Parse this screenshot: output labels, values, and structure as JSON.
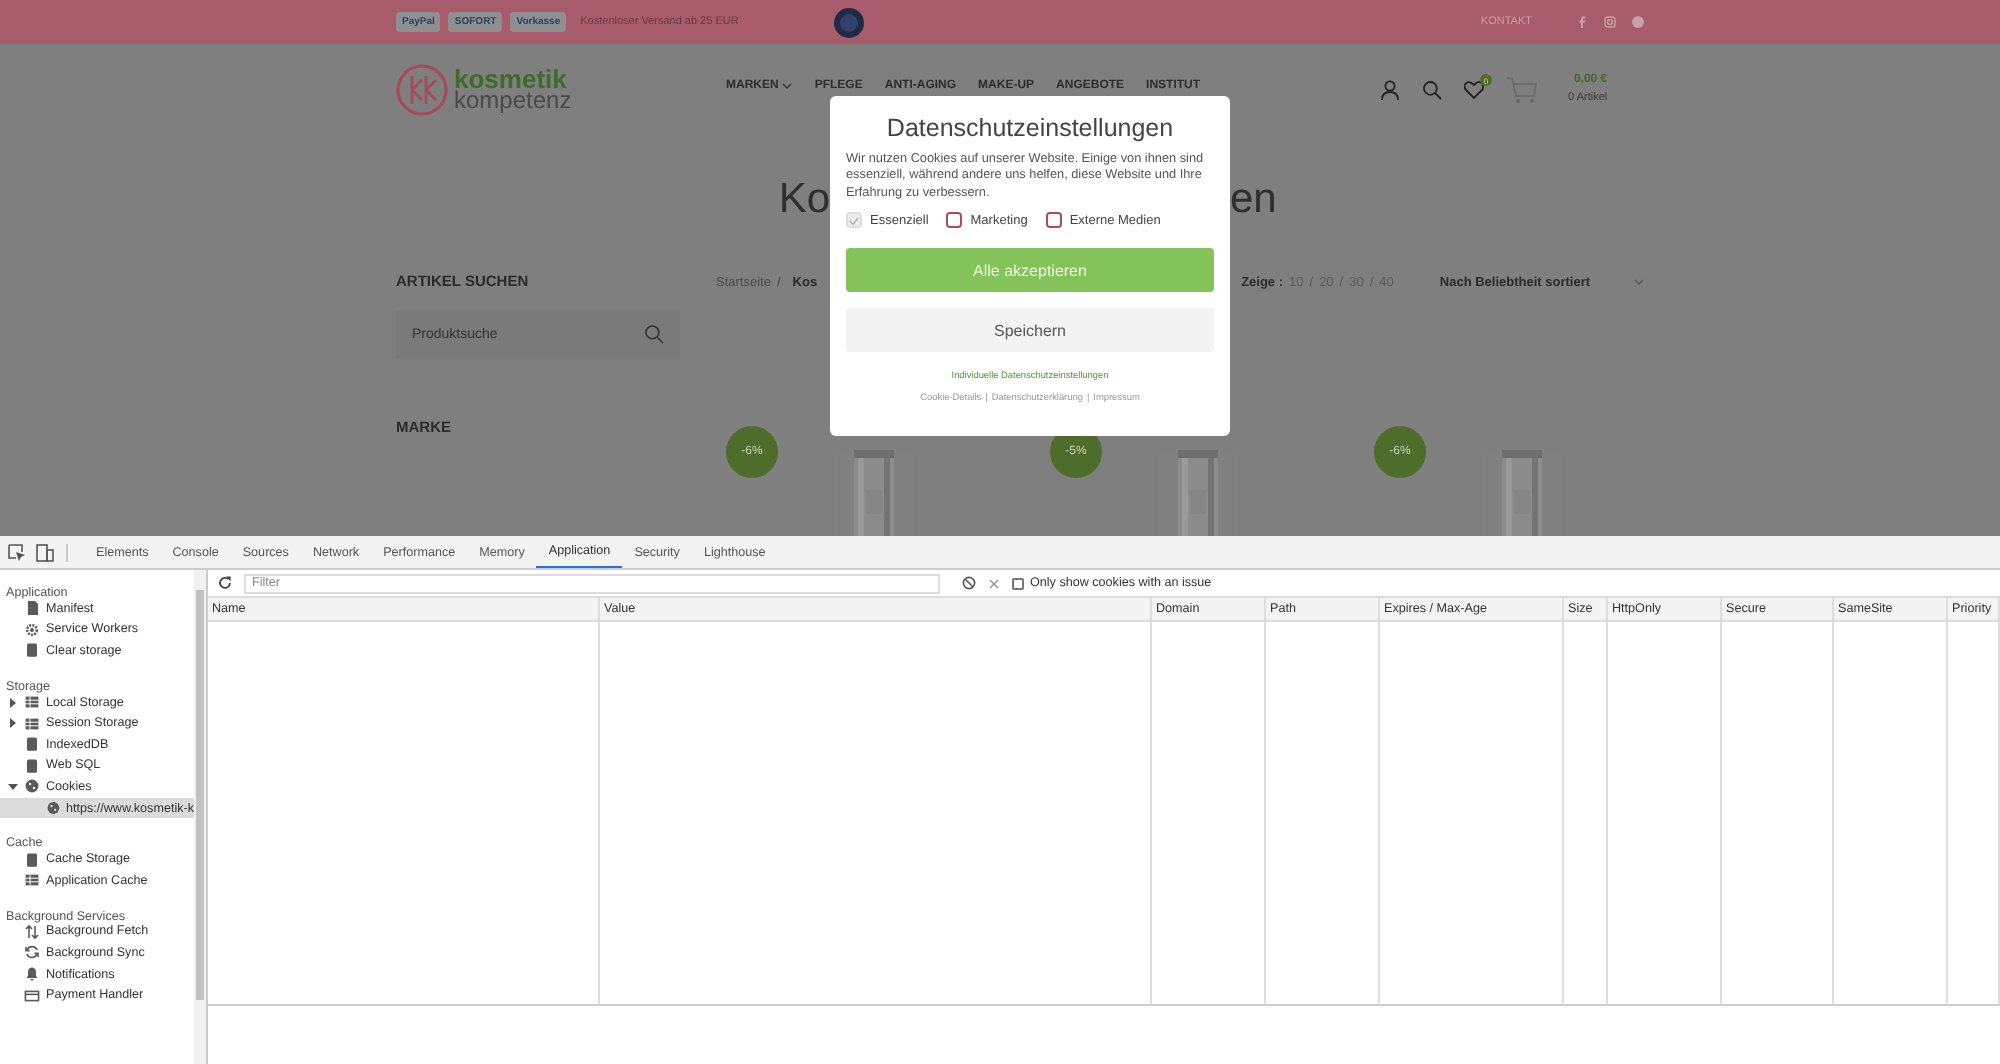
{
  "site": {
    "top_bar": {
      "payment_logos": [
        "PayPal",
        "SOFORT",
        "Vorkasse"
      ],
      "shipping_note": "Kostenloser Versand ab 25 EUR",
      "links": [
        "KONTAKT"
      ]
    },
    "logo": {
      "line_1": "kosmetik",
      "line_2": "kompetenz"
    },
    "nav": [
      {
        "label": "MARKEN",
        "dropdown": true
      },
      {
        "label": "PFLEGE",
        "dropdown": false
      },
      {
        "label": "ANTI-AGING",
        "dropdown": false
      },
      {
        "label": "MAKE-UP",
        "dropdown": false
      },
      {
        "label": "ANGEBOTE",
        "dropdown": false
      },
      {
        "label": "INSTITUT",
        "dropdown": false
      }
    ],
    "wishlist_count": "0",
    "cart": {
      "total": "0,00 €",
      "items": "0 Artikel"
    },
    "heading_left": "Ko",
    "heading_right": "en",
    "sidebar": {
      "search_title": "ARTIKEL SUCHEN",
      "search_placeholder": "Produktsuche",
      "filter_title": "MARKE"
    },
    "breadcrumb": {
      "home": "Startseite",
      "separator": "/",
      "current": "Kos"
    },
    "per_page": {
      "label": "Zeige :",
      "options": [
        "10",
        "20",
        "30",
        "40"
      ],
      "separator": "/"
    },
    "sort": "Nach Beliebtheit sortiert",
    "products": [
      {
        "badge": "-6%"
      },
      {
        "badge": "-5%"
      },
      {
        "badge": "-6%"
      }
    ]
  },
  "consent_dialog": {
    "title": "Datenschutzeinstellungen",
    "text": "Wir nutzen Cookies auf unserer Website. Einige von ihnen sind essenziell, während andere uns helfen, diese Website und Ihre Erfahrung zu verbessern.",
    "options": [
      {
        "label": "Essenziell",
        "checked": true,
        "disabled": true
      },
      {
        "label": "Marketing",
        "checked": false,
        "disabled": false
      },
      {
        "label": "Externe Medien",
        "checked": false,
        "disabled": false
      }
    ],
    "accept_all": "Alle akzeptieren",
    "save": "Speichern",
    "individual_link": "Individuelle Datenschutzeinstellungen",
    "footer_links": [
      "Cookie-Details",
      "Datenschutzerklärung",
      "Impressum"
    ],
    "footer_separator": "|"
  },
  "devtools": {
    "tabs": [
      {
        "label": "Elements",
        "selected": false
      },
      {
        "label": "Console",
        "selected": false
      },
      {
        "label": "Sources",
        "selected": false
      },
      {
        "label": "Network",
        "selected": false
      },
      {
        "label": "Performance",
        "selected": false
      },
      {
        "label": "Memory",
        "selected": false
      },
      {
        "label": "Application",
        "selected": true
      },
      {
        "label": "Security",
        "selected": false
      },
      {
        "label": "Lighthouse",
        "selected": false
      }
    ],
    "sidebar": [
      {
        "title": "Application",
        "items": [
          {
            "label": "Manifest",
            "kind": "file"
          },
          {
            "label": "Service Workers",
            "kind": "gear"
          },
          {
            "label": "Clear storage",
            "kind": "db"
          }
        ]
      },
      {
        "title": "Storage",
        "items": [
          {
            "label": "Local Storage",
            "kind": "grid",
            "expanded": false
          },
          {
            "label": "Session Storage",
            "kind": "grid",
            "expanded": false
          },
          {
            "label": "IndexedDB",
            "kind": "db"
          },
          {
            "label": "Web SQL",
            "kind": "db"
          },
          {
            "label": "Cookies",
            "kind": "cookie",
            "expanded": true,
            "children": [
              {
                "label": "https://www.kosmetik-k",
                "kind": "cookie",
                "selected": true
              }
            ]
          }
        ]
      },
      {
        "title": "Cache",
        "items": [
          {
            "label": "Cache Storage",
            "kind": "db"
          },
          {
            "label": "Application Cache",
            "kind": "grid"
          }
        ]
      },
      {
        "title": "Background Services",
        "items": [
          {
            "label": "Background Fetch",
            "kind": "arrows"
          },
          {
            "label": "Background Sync",
            "kind": "sync"
          },
          {
            "label": "Notifications",
            "kind": "bell"
          },
          {
            "label": "Payment Handler",
            "kind": "card"
          }
        ]
      }
    ],
    "filter": {
      "placeholder": "Filter"
    },
    "issue_only": {
      "label": "Only show cookies with an issue",
      "checked": false
    },
    "columns": [
      "Name",
      "Value",
      "Domain",
      "Path",
      "Expires / Max-Age",
      "Size",
      "HttpOnly",
      "Secure",
      "SameSite",
      "Priority"
    ]
  }
}
